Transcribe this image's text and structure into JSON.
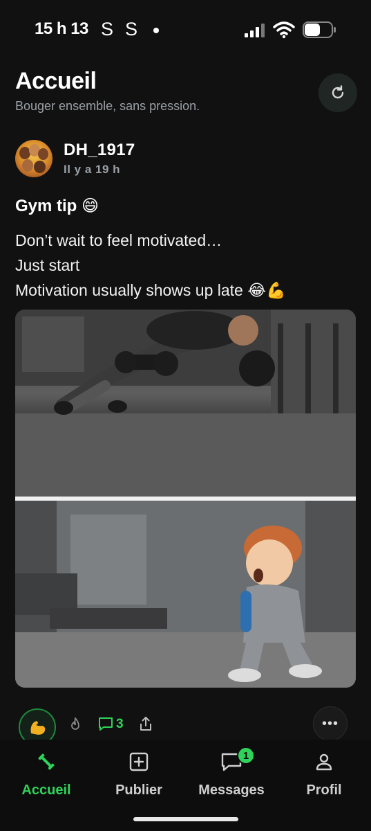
{
  "status_bar": {
    "time": "15 h 13",
    "indicators": [
      "S",
      "S"
    ],
    "icons": [
      "signal-icon",
      "wifi-icon",
      "battery-icon"
    ]
  },
  "header": {
    "title": "Accueil",
    "subtitle": "Bouger ensemble, sans pression.",
    "refresh_icon": "refresh-icon"
  },
  "post": {
    "author": "DH_1917",
    "time": "Il y a 19 h",
    "title": "Gym tip 😄",
    "lines": [
      "Don’t wait to feel motivated…",
      "Just start",
      "Motivation usually shows up late 😂💪"
    ],
    "comment_count": "3",
    "more_label": "•••"
  },
  "bottom_nav": {
    "items": [
      {
        "label": "Accueil",
        "icon": "dumbbell-icon",
        "active": true
      },
      {
        "label": "Publier",
        "icon": "plus-square-icon",
        "active": false
      },
      {
        "label": "Messages",
        "icon": "message-icon",
        "active": false,
        "badge": "1"
      },
      {
        "label": "Profil",
        "icon": "user-icon",
        "active": false
      }
    ]
  },
  "colors": {
    "background": "#111111",
    "accent": "#2fd35a",
    "muted_text": "#9aa0a6"
  }
}
